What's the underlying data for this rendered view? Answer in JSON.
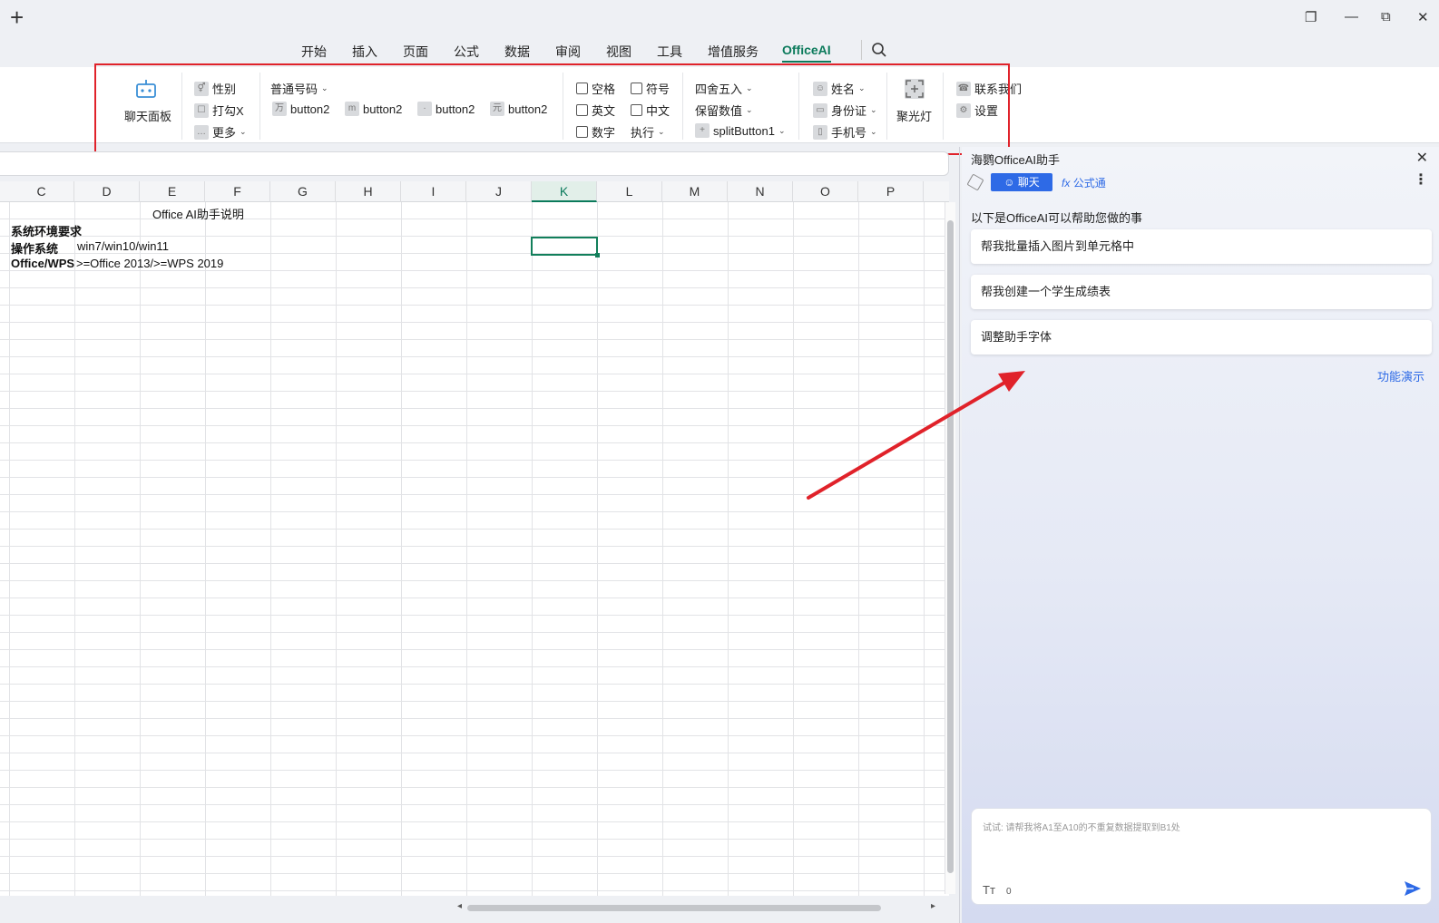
{
  "window": {
    "plus": "+",
    "controls": [
      "❐",
      "—",
      "⧉",
      "✕"
    ]
  },
  "menu": {
    "tabs": [
      "开始",
      "插入",
      "页面",
      "公式",
      "数据",
      "审阅",
      "视图",
      "工具",
      "增值服务",
      "OfficeAI"
    ],
    "active": "OfficeAI"
  },
  "ribbon": {
    "chat_panel": "聊天面板",
    "gender": "性别",
    "check_x": "打勾X",
    "more": "更多",
    "normal_number": "普通号码",
    "button2_labels": [
      "button2",
      "button2",
      "button2",
      "button2"
    ],
    "space": "空格",
    "symbol": "符号",
    "english": "英文",
    "chinese": "中文",
    "number": "数字",
    "execute": "执行",
    "round": "四舍五入",
    "keep_value": "保留数值",
    "split_button": "splitButton1",
    "name": "姓名",
    "id_card": "身份证",
    "phone": "手机号",
    "spotlight": "聚光灯",
    "contact": "联系我们",
    "settings": "设置"
  },
  "sheet": {
    "columns": [
      "C",
      "D",
      "E",
      "F",
      "G",
      "H",
      "I",
      "J",
      "K",
      "L",
      "M",
      "N",
      "O",
      "P"
    ],
    "selected_column": "K",
    "cells": {
      "title": "Office AI助手说明",
      "env_req": "系统环境要求",
      "os_label": "操作系统",
      "os_value": "win7/win10/win11",
      "office_label": "Office/WPS",
      "office_value": ">=Office 2013/>=WPS 2019"
    }
  },
  "panel": {
    "title": "海鹦OfficeAI助手",
    "chat_tab": "聊天",
    "formula_tab": "公式通",
    "intro": "以下是OfficeAI可以帮助您做的事",
    "suggestions": [
      "帮我批量插入图片到单元格中",
      "帮我创建一个学生成绩表",
      "调整助手字体"
    ],
    "demo_link": "功能演示",
    "input_placeholder": "试试: 请帮我将A1至A10的不重复数据提取到B1处",
    "char_count": "0",
    "font_icon": "Tт"
  },
  "colors": {
    "accent_green": "#0b7a5b",
    "panel_blue": "#2e6ae6",
    "annotation_red": "#e0222a"
  }
}
